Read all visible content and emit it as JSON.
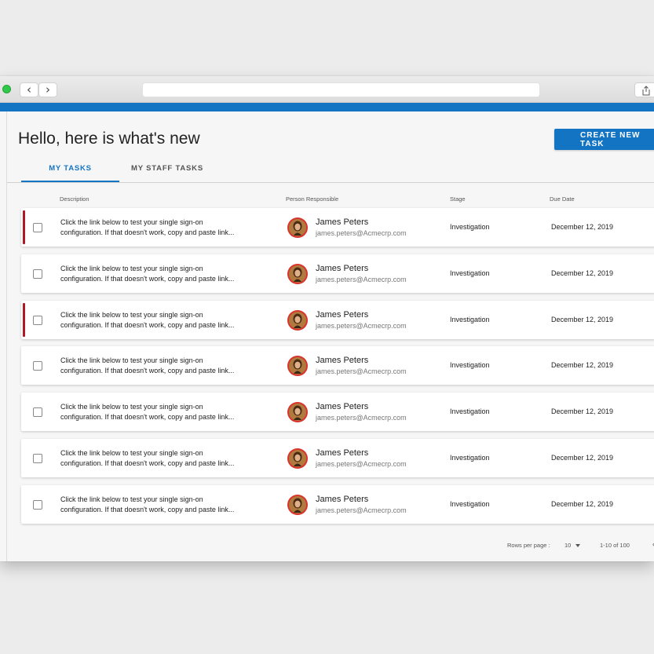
{
  "browser": {
    "back_glyph": "‹",
    "forward_glyph": "›",
    "address": "",
    "icons": [
      "back-arrow-icon",
      "forward-arrow-icon",
      "share-icon"
    ]
  },
  "colors": {
    "accent": "#1474c4",
    "flag": "#b01825",
    "status_light": "#2fc84a"
  },
  "header": {
    "title": "Hello, here is what's new",
    "create_button": "CREATE NEW TASK"
  },
  "tabs": [
    {
      "label": "MY TASKS",
      "active": true
    },
    {
      "label": "MY STAFF TASKS",
      "active": false
    }
  ],
  "table": {
    "columns": [
      "Description",
      "Person Responsible",
      "Stage",
      "Due Date"
    ],
    "rows": [
      {
        "flagged": true,
        "desc_line1": "Click the link below to test your single sign-on",
        "desc_line2": "configuration. If that doesn't work, copy and paste link...",
        "name": "James Peters",
        "email": "james.peters@Acmecrp.com",
        "stage": "Investigation",
        "due": "December 12, 2019"
      },
      {
        "flagged": false,
        "desc_line1": "Click the link below to test your single sign-on",
        "desc_line2": "configuration. If that doesn't work, copy and paste link...",
        "name": "James Peters",
        "email": "james.peters@Acmecrp.com",
        "stage": "Investigation",
        "due": "December 12, 2019"
      },
      {
        "flagged": true,
        "desc_line1": "Click the link below to test your single sign-on",
        "desc_line2": "configuration. If that doesn't work, copy and paste link...",
        "name": "James Peters",
        "email": "james.peters@Acmecrp.com",
        "stage": "Investigation",
        "due": "December 12, 2019"
      },
      {
        "flagged": false,
        "desc_line1": "Click the link below to test your single sign-on",
        "desc_line2": "configuration. If that doesn't work, copy and paste link...",
        "name": "James Peters",
        "email": "james.peters@Acmecrp.com",
        "stage": "Investigation",
        "due": "December 12, 2019"
      },
      {
        "flagged": false,
        "desc_line1": "Click the link below to test your single sign-on",
        "desc_line2": "configuration. If that doesn't work, copy and paste link...",
        "name": "James Peters",
        "email": "james.peters@Acmecrp.com",
        "stage": "Investigation",
        "due": "December 12, 2019"
      },
      {
        "flagged": false,
        "desc_line1": "Click the link below to test your single sign-on",
        "desc_line2": "configuration. If that doesn't work, copy and paste link...",
        "name": "James Peters",
        "email": "james.peters@Acmecrp.com",
        "stage": "Investigation",
        "due": "December 12, 2019"
      },
      {
        "flagged": false,
        "desc_line1": "Click the link below to test your single sign-on",
        "desc_line2": "configuration. If that doesn't work, copy and paste link...",
        "name": "James Peters",
        "email": "james.peters@Acmecrp.com",
        "stage": "Investigation",
        "due": "December 12, 2019"
      }
    ]
  },
  "pagination": {
    "rows_per_page_label": "Rows per page :",
    "rows_per_page_value": "10",
    "range": "1-10 of 100",
    "prev_glyph": "‹"
  }
}
